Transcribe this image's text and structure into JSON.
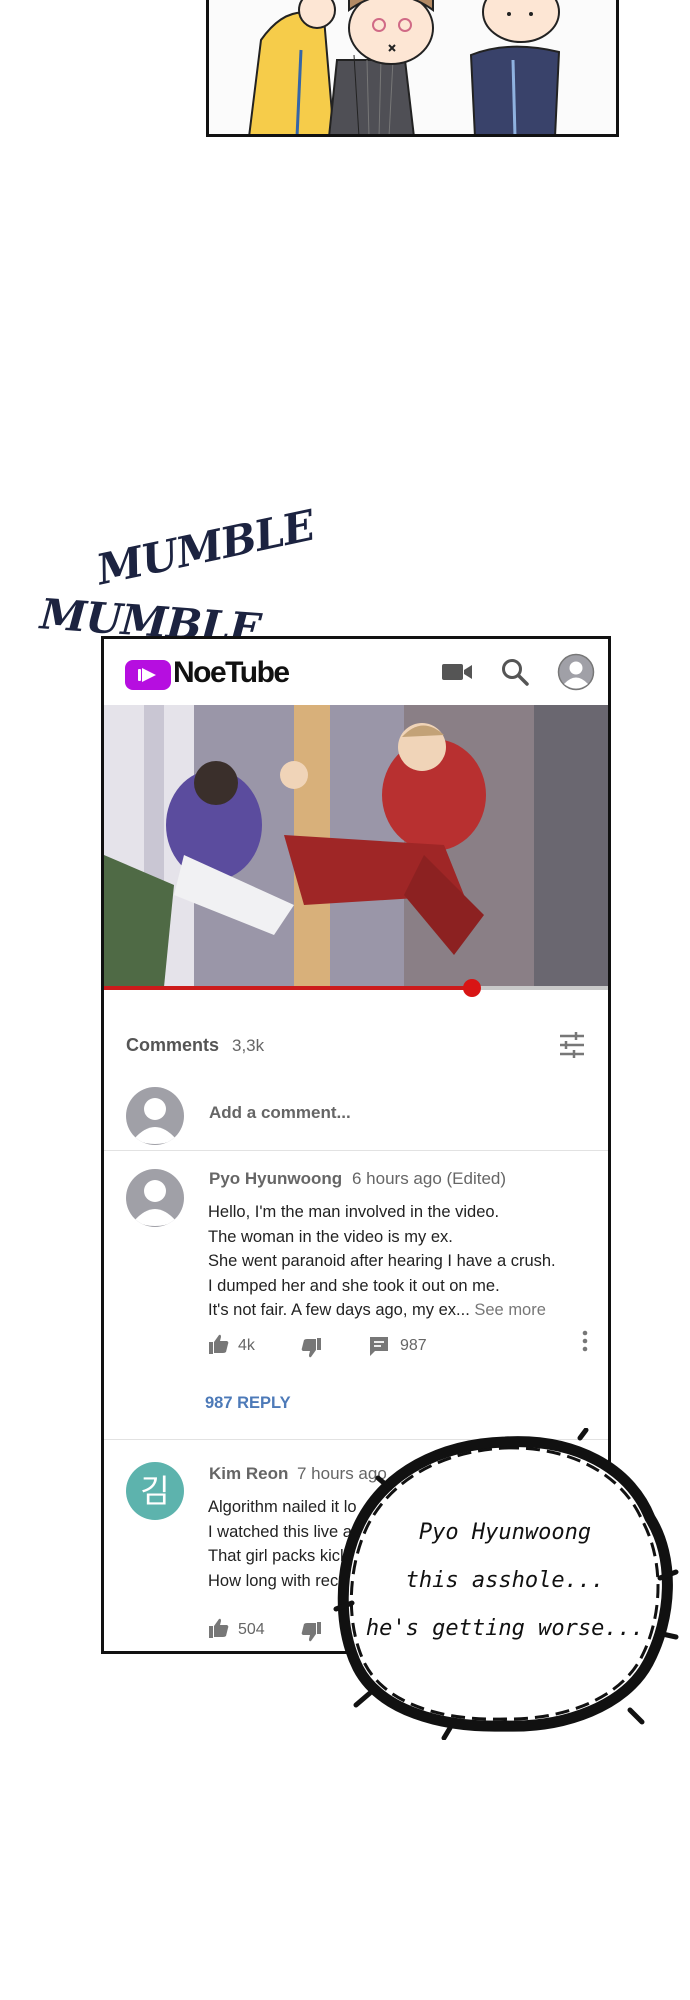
{
  "sfx": [
    "MUMBLE",
    "MUMBLE"
  ],
  "app": {
    "brand": "NoeTube",
    "icons": [
      "video-camera-icon",
      "search-icon",
      "account-icon"
    ]
  },
  "video": {
    "progress": 0.73
  },
  "comments": {
    "title": "Comments",
    "count": "3,3k",
    "add_placeholder": "Add a comment...",
    "items": [
      {
        "author": "Pyo Hyunwoong",
        "time": "6 hours ago (Edited)",
        "lines": [
          "Hello, I'm the man involved in the video.",
          "The woman in the video is my ex.",
          "She went paranoid after hearing I have a crush.",
          "I dumped her and she took it out on me.",
          "It's not fair. A few days ago, my ex..."
        ],
        "see_more": "See more",
        "likes": "4k",
        "replies_count": "987",
        "reply_link": "987 REPLY"
      },
      {
        "author": "Kim Reon",
        "time": "7 hours ago",
        "avatar_initial": "김",
        "lines": [
          "Algorithm nailed it lo",
          "I watched this live a",
          "That girl packs kick",
          "How long with recov"
        ],
        "likes": "504"
      }
    ]
  },
  "narration": {
    "lines": [
      "Pyo Hyunwoong",
      "this asshole...",
      "he's getting worse..."
    ]
  },
  "colors": {
    "brand_purple": "#b60ee0",
    "progress_red": "#cc1b1b",
    "reply_blue": "#4d7ab8",
    "kim_avatar": "#5db3ad"
  }
}
